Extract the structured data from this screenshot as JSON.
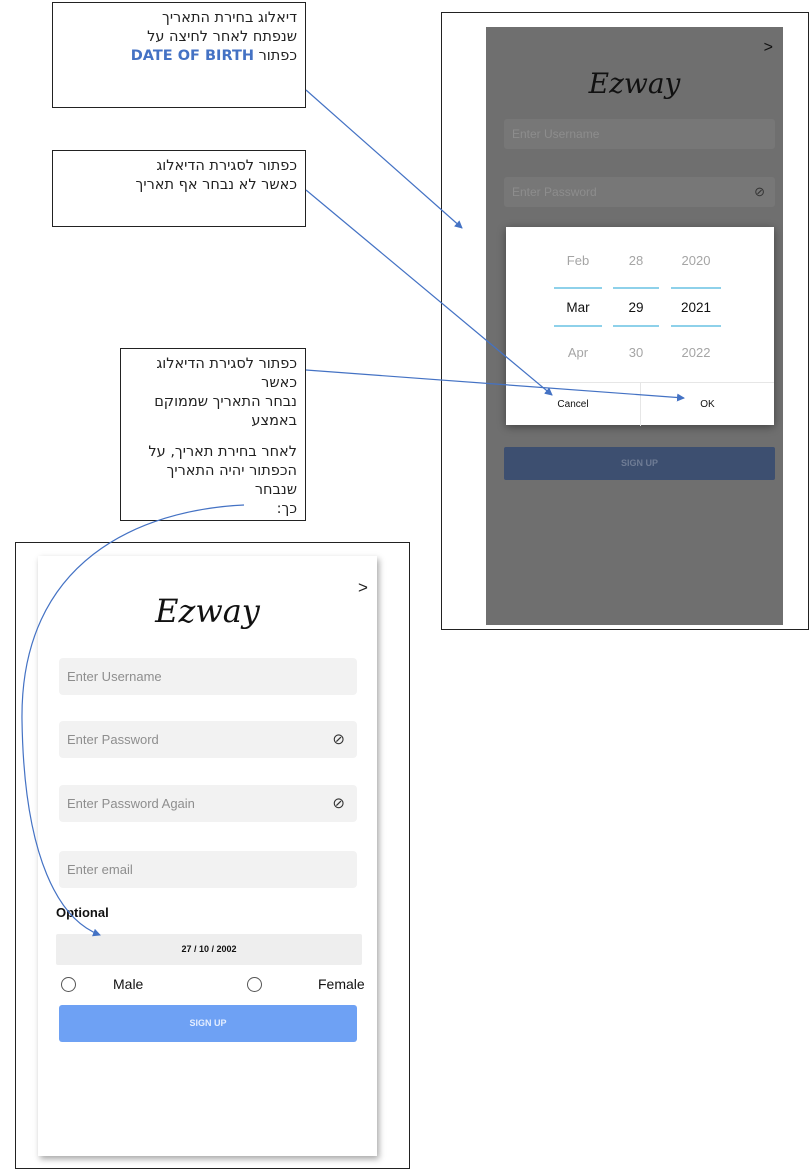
{
  "notes": {
    "note1_line1": "דיאלוג בחירת התאריך",
    "note1_line2": "שנפתח לאחר לחיצה על",
    "note1_line3_prefix": "כפתור ",
    "note1_line3_blue": "DATE OF BIRTH",
    "note2_line1": "כפתור לסגירת הדיאלוג",
    "note2_line2": "כאשר לא נבחר אף תאריך",
    "note3_line1": "כפתור לסגירת הדיאלוג כאשר",
    "note3_line2": "נבחר התאריך שממוקם באמצע",
    "note3_line3": "לאחר בחירת תאריך, על",
    "note3_line4": "הכפתור יהיה התאריך שנבחר",
    "note3_line5": "כך:"
  },
  "screen1": {
    "back": ">",
    "logo": "Ezway",
    "username_placeholder": "Enter Username",
    "password_placeholder": "Enter Password",
    "eye": "⊘",
    "signup": "SIGN UP",
    "picker": {
      "months": [
        "Feb",
        "Mar",
        "Apr"
      ],
      "days": [
        "28",
        "29",
        "30"
      ],
      "years": [
        "2020",
        "2021",
        "2022"
      ],
      "cancel": "Cancel",
      "ok": "OK"
    }
  },
  "screen2": {
    "back": ">",
    "logo": "Ezway",
    "username_placeholder": "Enter Username",
    "password_placeholder": "Enter Password",
    "password_again_placeholder": "Enter Password Again",
    "email_placeholder": "Enter email",
    "eye": "⊘",
    "optional_label": "Optional",
    "date_value": "27 / 10 / 2002",
    "male_label": "Male",
    "female_label": "Female",
    "signup": "SIGN UP"
  }
}
